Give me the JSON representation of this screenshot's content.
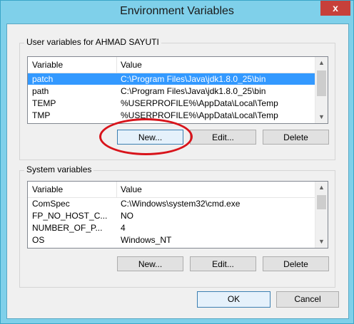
{
  "window": {
    "title": "Environment Variables",
    "close_symbol": "x"
  },
  "user_section": {
    "label": "User variables for AHMAD SAYUTI",
    "columns": [
      "Variable",
      "Value"
    ],
    "rows": [
      {
        "variable": "patch",
        "value": "C:\\Program Files\\Java\\jdk1.8.0_25\\bin",
        "selected": true
      },
      {
        "variable": "path",
        "value": "C:\\Program Files\\Java\\jdk1.8.0_25\\bin",
        "selected": false
      },
      {
        "variable": "TEMP",
        "value": "%USERPROFILE%\\AppData\\Local\\Temp",
        "selected": false
      },
      {
        "variable": "TMP",
        "value": "%USERPROFILE%\\AppData\\Local\\Temp",
        "selected": false
      }
    ],
    "buttons": {
      "new": "New...",
      "edit": "Edit...",
      "delete": "Delete"
    }
  },
  "system_section": {
    "label": "System variables",
    "columns": [
      "Variable",
      "Value"
    ],
    "rows": [
      {
        "variable": "ComSpec",
        "value": "C:\\Windows\\system32\\cmd.exe"
      },
      {
        "variable": "FP_NO_HOST_C...",
        "value": "NO"
      },
      {
        "variable": "NUMBER_OF_P...",
        "value": "4"
      },
      {
        "variable": "OS",
        "value": "Windows_NT"
      }
    ],
    "buttons": {
      "new": "New...",
      "edit": "Edit...",
      "delete": "Delete"
    }
  },
  "dialog_buttons": {
    "ok": "OK",
    "cancel": "Cancel"
  },
  "colors": {
    "selection": "#3399ff",
    "highlight_circle": "#d8141b"
  }
}
